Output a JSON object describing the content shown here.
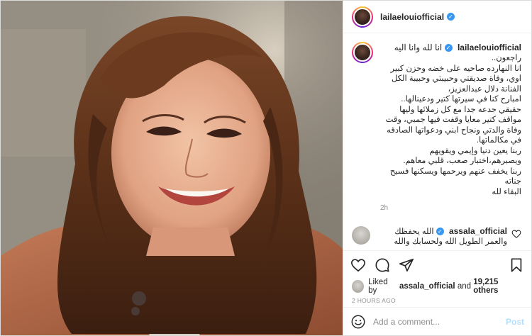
{
  "post": {
    "photo_alt": "",
    "author": {
      "username": "lailaelouiofficial",
      "verified": true
    },
    "caption": {
      "username": "lailaelouiofficial",
      "lines": [
        "انا لله وانا اليه",
        "راجعون..",
        "انا النهارده صاحيه على خضه وحزن كبير",
        "اوي، وفاة صديقتي وحبيبتي وحبيبة الكل",
        "الفنانة دلال عبدالعزيز،",
        "امبارح كنا في سيرتها كتير ودعينالها..",
        "حقيقي جدعه جدا مع كل زملائها وليها",
        "مواقف كتير معايا وقفت فيها جمبي، وقت",
        "وفاة والدتي ونجاح ابني ودعواتها الصادقه",
        "في مكالماتها.",
        "ربنا يعين دنيا وإيمي ويقويهم",
        "ويصبرهم،اختبار صعب، قلبي معاهم.",
        "ربنا يخفف عنهم ويرحمها ويسكنها فسيح",
        "جناته",
        "البقاء لله"
      ],
      "time": "2h"
    },
    "comment": {
      "username": "assala_official",
      "lines": [
        "الله يحفظك",
        "والعمر الطويل الله ولحسابك والله"
      ]
    },
    "likes": {
      "prefix": "Liked by",
      "user": "assala_official",
      "and": "and",
      "count": "19,215 others"
    },
    "posted_ago": "2 HOURS AGO",
    "add_comment": {
      "placeholder": "Add a comment...",
      "post_label": "Post"
    },
    "colors": {
      "link_blue": "#3897f0",
      "post_disabled": "#b2dffc",
      "muted": "#8e8e8e"
    }
  }
}
